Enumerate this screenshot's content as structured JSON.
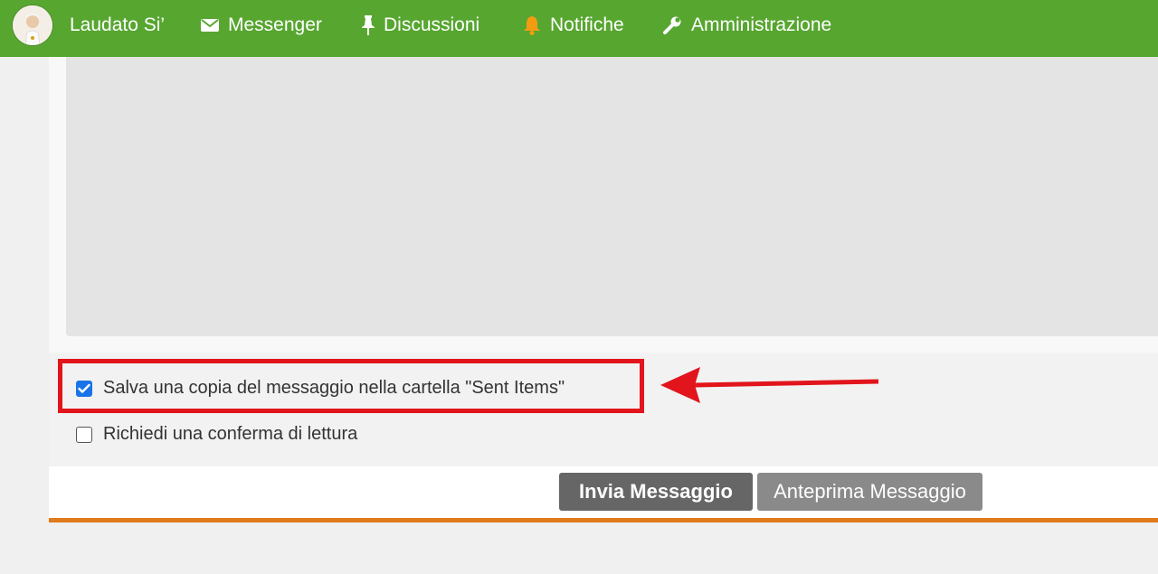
{
  "navbar": {
    "brand": "Laudato Si’",
    "items": [
      {
        "label": "Messenger",
        "icon": "envelope-icon"
      },
      {
        "label": "Discussioni",
        "icon": "pin-icon"
      },
      {
        "label": "Notifiche",
        "icon": "bell-icon"
      },
      {
        "label": "Amministrazione",
        "icon": "wrench-icon"
      }
    ],
    "colors": {
      "background": "#57a630",
      "bell": "#f39c12"
    }
  },
  "options": {
    "save_copy": {
      "label": "Salva una copia del messaggio nella cartella \"Sent Items\"",
      "checked": true
    },
    "read_receipt": {
      "label": "Richiedi una conferma di lettura",
      "checked": false
    }
  },
  "buttons": {
    "send": "Invia Messaggio",
    "preview": "Anteprima Messaggio"
  },
  "annotation": {
    "color": "#e2141c"
  },
  "accent": "#e07a1a"
}
